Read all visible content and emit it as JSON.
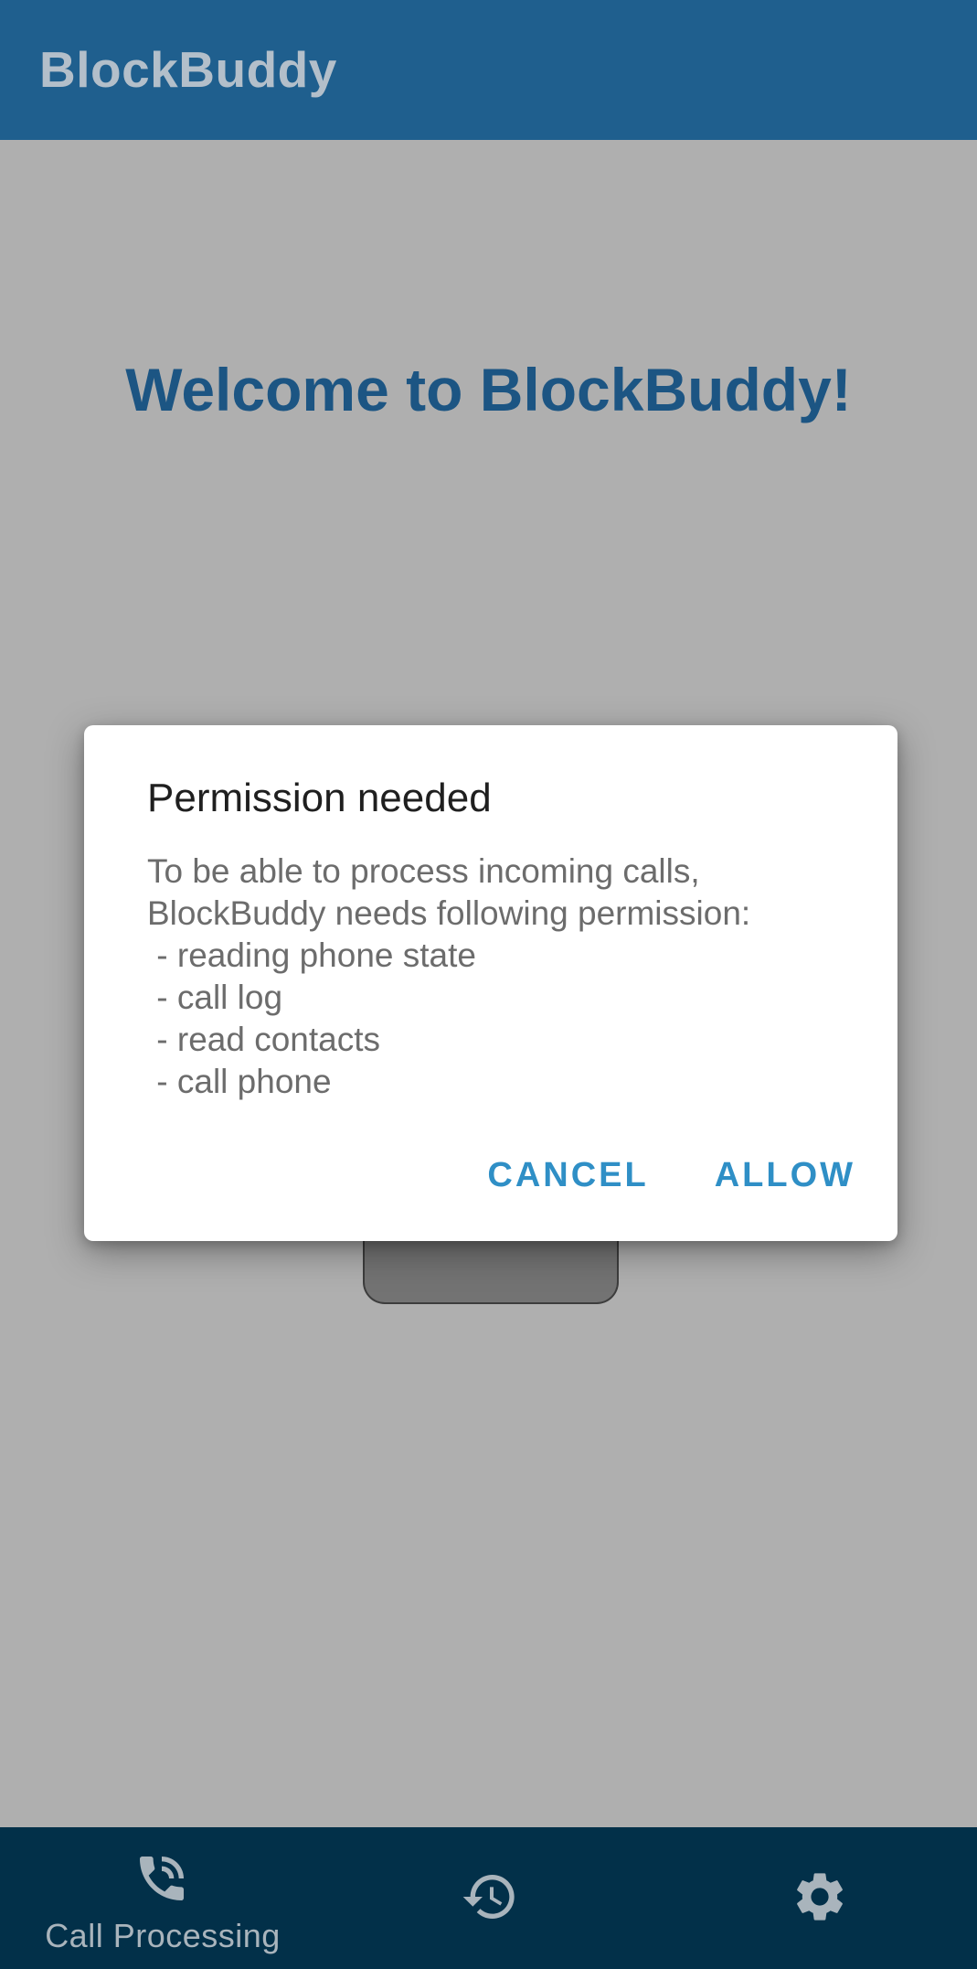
{
  "app": {
    "title": "BlockBuddy"
  },
  "main": {
    "welcome_text": "Welcome to BlockBuddy!"
  },
  "dialog": {
    "title": "Permission needed",
    "body_lines": [
      "To be able to process incoming calls,",
      "BlockBuddy needs following permission:",
      " - reading phone state",
      " - call log",
      " - read contacts",
      " - call phone"
    ],
    "cancel_label": "CANCEL",
    "allow_label": "ALLOW"
  },
  "bottom_nav": {
    "items": [
      {
        "label": "Call Processing",
        "icon": "phone-call-icon",
        "selected": true
      },
      {
        "label": "",
        "icon": "history-icon",
        "selected": false
      },
      {
        "label": "",
        "icon": "gear-icon",
        "selected": false
      }
    ]
  },
  "colors": {
    "app_bar": "#1f5f8e",
    "bottom_nav": "#023049",
    "accent": "#2f8fc6",
    "welcome_text": "#1c5583",
    "scrim_background": "#afafaf"
  }
}
